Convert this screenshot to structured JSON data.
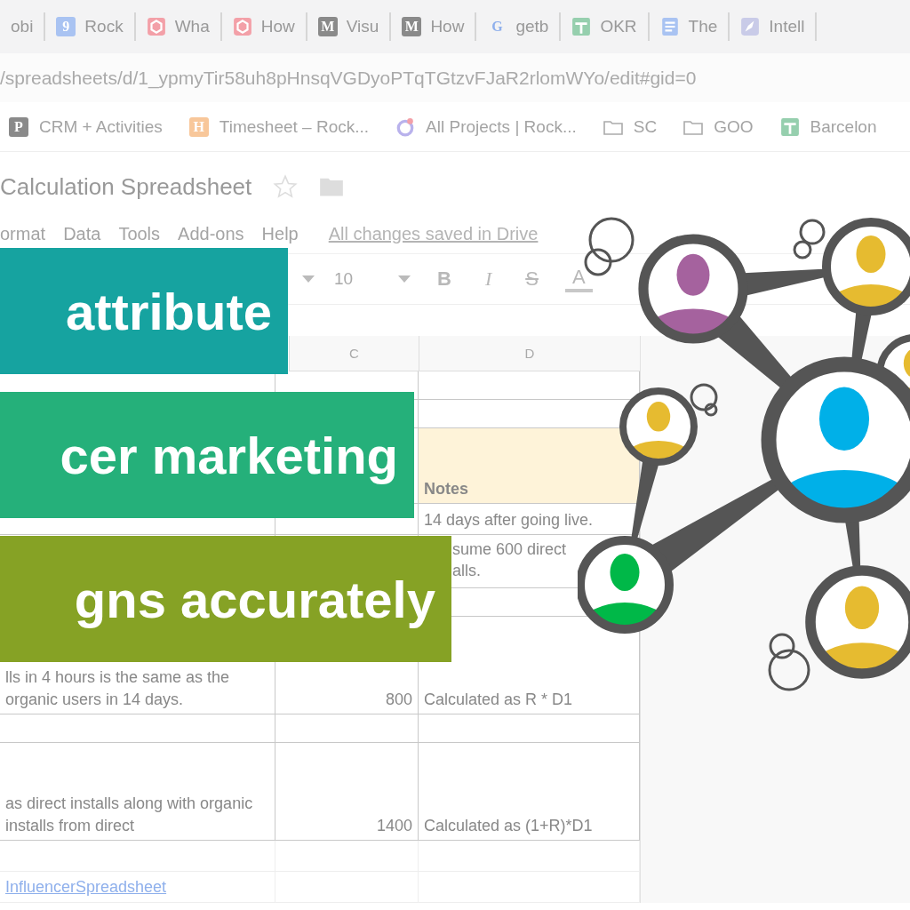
{
  "browser": {
    "tabs": [
      {
        "label": "obi",
        "kind": "none"
      },
      {
        "label": "Rock",
        "kind": "calendar",
        "glyph": "9"
      },
      {
        "label": "Wha",
        "kind": "shield"
      },
      {
        "label": "How",
        "kind": "shield"
      },
      {
        "label": "Visu",
        "kind": "letter",
        "glyph": "M"
      },
      {
        "label": "How",
        "kind": "letter",
        "glyph": "M"
      },
      {
        "label": "getb",
        "kind": "google",
        "glyph": "G"
      },
      {
        "label": "OKR",
        "kind": "sheet"
      },
      {
        "label": "The",
        "kind": "doc"
      },
      {
        "label": "Intell",
        "kind": "rocket"
      }
    ],
    "address": "/spreadsheets/d/1_ypmyTir58uh8pHnsqVGDyoPTqTGtzvFJaR2rlomWYo/edit#gid=0",
    "bookmarks": [
      {
        "label": "CRM + Activities",
        "kind": "letter",
        "glyph": "P"
      },
      {
        "label": "Timesheet – Rock...",
        "kind": "orange",
        "glyph": "H"
      },
      {
        "label": "All Projects | Rock...",
        "kind": "ring"
      },
      {
        "label": "SC",
        "kind": "folder"
      },
      {
        "label": "GOO",
        "kind": "folder"
      },
      {
        "label": "Barcelon",
        "kind": "sheet"
      }
    ]
  },
  "doc": {
    "title": "Calculation Spreadsheet",
    "starred": false,
    "menu": [
      "ormat",
      "Data",
      "Tools",
      "Add-ons",
      "Help"
    ],
    "save_status": "All changes saved in Drive",
    "font_size": "10",
    "format_buttons": [
      {
        "label": "B",
        "kind": "bold"
      },
      {
        "label": "I",
        "kind": "italic"
      },
      {
        "label": "S",
        "kind": "strike"
      },
      {
        "label": "A",
        "kind": "color"
      }
    ]
  },
  "sheet": {
    "columns": [
      "C",
      "D"
    ],
    "rows": [
      {
        "kind": "spacer"
      },
      {
        "kind": "spacer"
      },
      {
        "kind": "header",
        "d": "Notes"
      },
      {
        "kind": "data",
        "d": "14 days after going live."
      },
      {
        "kind": "covered",
        "d": "sume 600 direct alls."
      },
      {
        "kind": "spacer"
      },
      {
        "kind": "tall",
        "a": "lls in 4 hours is the same as the organic users in 14 days.",
        "c": "800",
        "d": "Calculated as R * D1"
      },
      {
        "kind": "spacer"
      },
      {
        "kind": "tall",
        "a": "as direct installs along with organic installs from direct",
        "c": "1400",
        "d": "Calculated as (1+R)*D1"
      },
      {
        "kind": "plain"
      },
      {
        "kind": "link",
        "a": "InfluencerSpreadsheet"
      }
    ]
  },
  "banners": [
    {
      "text": "attribute",
      "color": "#16a3a0"
    },
    {
      "text": "cer marketing",
      "color": "#25b07a"
    },
    {
      "text": "gns accurately",
      "color": "#86a225"
    }
  ]
}
